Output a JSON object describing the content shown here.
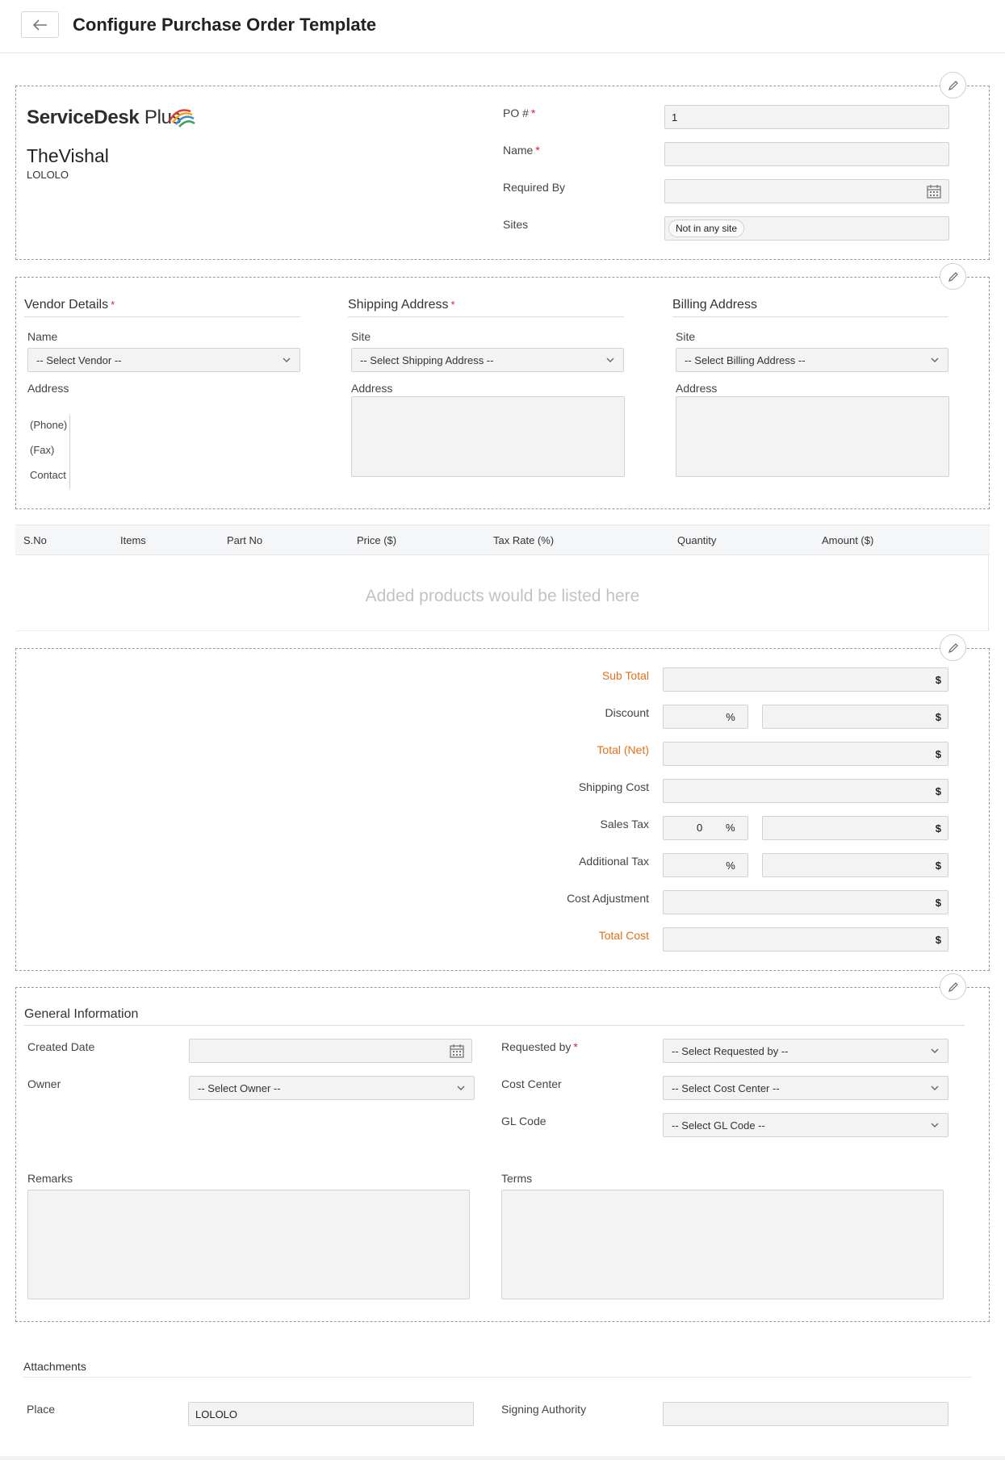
{
  "header": {
    "title": "Configure Purchase Order Template",
    "back_icon": "arrow-left-icon"
  },
  "org": {
    "logo_main": "ServiceDesk",
    "logo_plus": "Plus",
    "name": "TheVishal",
    "subtitle": "LOLOLO"
  },
  "po_fields": {
    "po_number_label": "PO #",
    "po_number_value": "1",
    "name_label": "Name",
    "required_by_label": "Required By",
    "sites_label": "Sites",
    "sites_value": "Not in any site"
  },
  "vendor": {
    "heading": "Vendor Details",
    "name_label": "Name",
    "select_placeholder": "-- Select Vendor --",
    "address_label": "Address",
    "phone": "(Phone)",
    "fax": "(Fax)",
    "contact": "Contact"
  },
  "shipping": {
    "heading": "Shipping Address",
    "site_label": "Site",
    "select_placeholder": "-- Select Shipping Address --",
    "address_label": "Address"
  },
  "billing": {
    "heading": "Billing Address",
    "site_label": "Site",
    "select_placeholder": "-- Select Billing Address --",
    "address_label": "Address"
  },
  "items_table": {
    "columns": [
      "S.No",
      "Items",
      "Part No",
      "Price ($)",
      "Tax Rate (%)",
      "Quantity",
      "Amount ($)"
    ],
    "empty_message": "Added products would be listed here"
  },
  "totals": {
    "sub_total": "Sub Total",
    "discount": "Discount",
    "total_net": "Total (Net)",
    "shipping_cost": "Shipping Cost",
    "sales_tax": "Sales Tax",
    "sales_tax_value": "0",
    "additional_tax": "Additional Tax",
    "cost_adjustment": "Cost Adjustment",
    "total_cost": "Total Cost",
    "currency": "$",
    "percent": "%"
  },
  "general": {
    "heading": "General Information",
    "created_date_label": "Created Date",
    "owner_label": "Owner",
    "owner_placeholder": "-- Select Owner --",
    "requested_by_label": "Requested by",
    "requested_by_placeholder": "-- Select Requested by --",
    "cost_center_label": "Cost Center",
    "cost_center_placeholder": "-- Select Cost Center --",
    "gl_code_label": "GL Code",
    "gl_code_placeholder": "-- Select GL Code --",
    "remarks_label": "Remarks",
    "terms_label": "Terms"
  },
  "attachments": {
    "heading": "Attachments",
    "place_label": "Place",
    "place_value": "LOLOLO",
    "signing_authority_label": "Signing Authority"
  },
  "colors": {
    "required": "#d9232e",
    "orange_label": "#e0701a"
  }
}
